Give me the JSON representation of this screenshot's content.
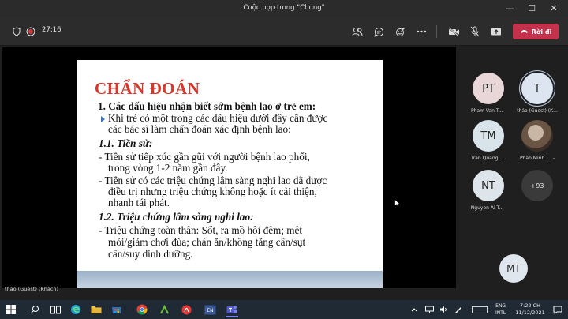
{
  "window": {
    "title": "Cuộc họp trong \"Chung\""
  },
  "toolbar": {
    "timer": "27:16",
    "leave_label": "Rời đi"
  },
  "slide": {
    "heading": "CHẨN ĐOÁN",
    "section1_num": "1. ",
    "section1_title": "Các dấu hiệu nhận biết sớm bệnh lao ở trẻ em:",
    "intro_line1": "Khi trẻ có một trong các dấu hiệu dưới đây cần được",
    "intro_line2": "các bác sĩ làm chẩn đoán xác định bệnh lao:",
    "sub1": "1.1. Tiền sử:",
    "sub1_item1_line1": "- Tiền sử tiếp xúc gần gũi với người bệnh lao phổi,",
    "sub1_item1_line2": "trong vòng 1-2 năm gần đây.",
    "sub1_item2_line1": "- Tiền sử có các triệu chứng lâm sàng nghi lao đã được",
    "sub1_item2_line2": "điều trị nhưng triệu chứng không hoặc ít cải thiện,",
    "sub1_item2_line3": "nhanh tái phát.",
    "sub2": "1.2. Triệu chứng lâm sàng nghi lao:",
    "sub2_item1_line1": "- Triệu chứng toàn thân: Sốt, ra mồ hôi đêm; mệt",
    "sub2_item1_line2": "mỏi/giảm chơi đùa; chán ăn/không tăng cân/sụt",
    "sub2_item1_line3": "cân/suy dinh dưỡng."
  },
  "presenter_caption": "thảo (Guest) (Khách)",
  "participants": [
    {
      "initials": "PT",
      "name": "Pham Van T...",
      "color": "#e9d6d8"
    },
    {
      "initials": "T",
      "name": "thảo (Guest) (K...",
      "color": "#dde6f0"
    },
    {
      "initials": "TM",
      "name": "Tran Quang...",
      "color": "#d8e4ea"
    },
    {
      "initials": "",
      "name": "Phan Minh ...",
      "color": "#8a6a55"
    },
    {
      "initials": "NT",
      "name": "Nguyen Ai T...",
      "color": "#dde4ea"
    },
    {
      "initials": "+93",
      "name": "",
      "color": "#3a3a3a"
    },
    {
      "initials": "MT",
      "name": "",
      "color": "#dfe6ee"
    }
  ],
  "taskbar": {
    "lang_line1": "ENG",
    "lang_line2": "INTL",
    "time": "7:22 CH",
    "date": "11/12/2021",
    "input_badge": "EN"
  }
}
